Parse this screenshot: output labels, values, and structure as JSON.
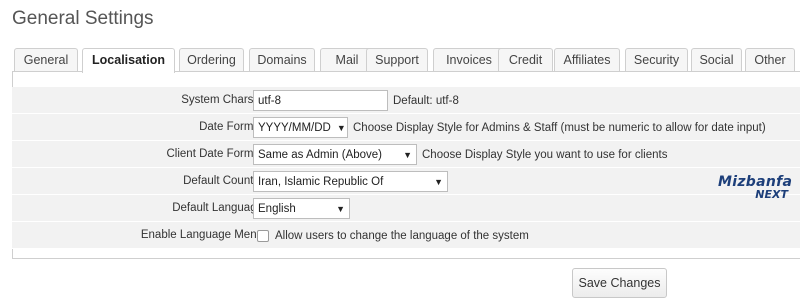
{
  "page": {
    "title": "General Settings"
  },
  "tabs": [
    {
      "label": "General",
      "active": false
    },
    {
      "label": "Localisation",
      "active": true
    },
    {
      "label": "Ordering",
      "active": false
    },
    {
      "label": "Domains",
      "active": false
    },
    {
      "label": "Mail",
      "active": false
    },
    {
      "label": "Support",
      "active": false
    },
    {
      "label": "Invoices",
      "active": false
    },
    {
      "label": "Credit",
      "active": false
    },
    {
      "label": "Affiliates",
      "active": false
    },
    {
      "label": "Security",
      "active": false
    },
    {
      "label": "Social",
      "active": false
    },
    {
      "label": "Other",
      "active": false
    }
  ],
  "form": {
    "system_charset": {
      "label": "System Charset",
      "value": "utf-8",
      "hint": "Default: utf-8"
    },
    "date_format": {
      "label": "Date Format",
      "value": "YYYY/MM/DD",
      "hint": "Choose Display Style for Admins & Staff (must be numeric to allow for date input)"
    },
    "client_date_format": {
      "label": "Client Date Format",
      "value": "Same as Admin (Above)",
      "hint": "Choose Display Style you want to use for clients"
    },
    "default_country": {
      "label": "Default Country",
      "value": "Iran, Islamic Republic Of"
    },
    "default_language": {
      "label": "Default Language",
      "value": "English"
    },
    "enable_language_menu": {
      "label": "Enable Language Menu",
      "checked": false,
      "hint": "Allow users to change the language of the system"
    }
  },
  "logo": {
    "line1": "Mizbanfa",
    "line2": "NEXT"
  },
  "actions": {
    "save_label": "Save Changes"
  },
  "colors": {
    "row_bg": "#f2f2f2",
    "border": "#cfcfcf",
    "logo": "#1d3f7a"
  }
}
